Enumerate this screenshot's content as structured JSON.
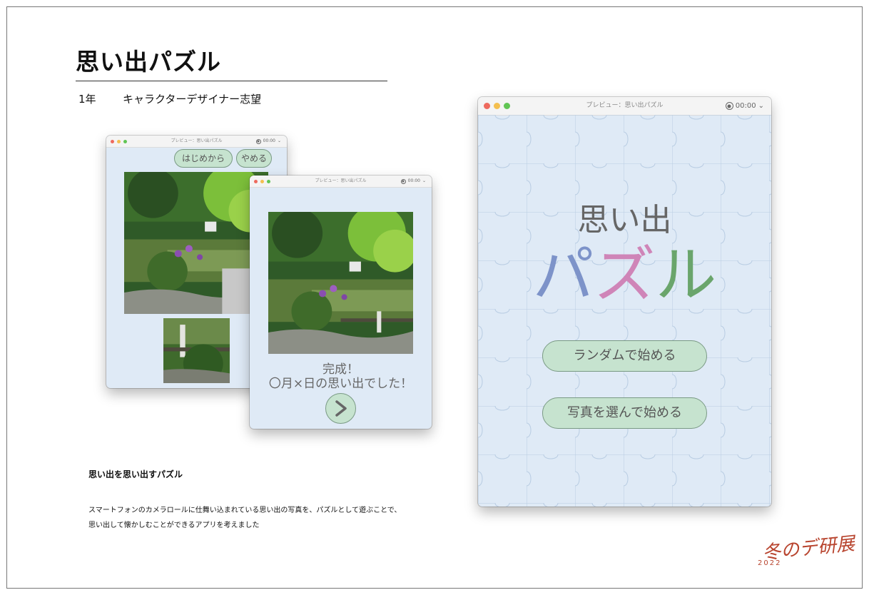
{
  "page": {
    "title": "思い出パズル",
    "grade": "1年",
    "aspiration": "キャラクターデザイナー志望",
    "description_title": "思い出を思い出すパズル",
    "description_lines": [
      "スマートフォンのカメラロールに仕舞い込まれている思い出の写真を、パズルとして遊ぶことで、",
      "思い出して懐かしむことができるアプリを考えました"
    ],
    "logo_text": "冬のデ研展",
    "logo_year": "2022"
  },
  "window_title": "プレビュー：思い出パズル",
  "timer": "00:00",
  "puzzle_screen": {
    "restart_button": "はじめから",
    "quit_button": "やめる"
  },
  "complete_screen": {
    "line1": "完成！",
    "line2": "〇月×日の思い出でした！",
    "next_button": ">"
  },
  "title_screen": {
    "title_top": "思い出",
    "title_chars": [
      "パ",
      "ズ",
      "ル"
    ],
    "random_button": "ランダムで始める",
    "choose_button": "写真を選んで始める"
  },
  "colors": {
    "background": "#dfeaf6",
    "button": "#c6e3cf",
    "char_pa": "#7d93c9",
    "char_zu": "#cf85b8",
    "char_ru": "#6aa56c",
    "logo": "#b8442e"
  },
  "icons": {
    "record": "record-icon",
    "chevron": "chevron-down-icon",
    "next": "chevron-right-icon"
  }
}
